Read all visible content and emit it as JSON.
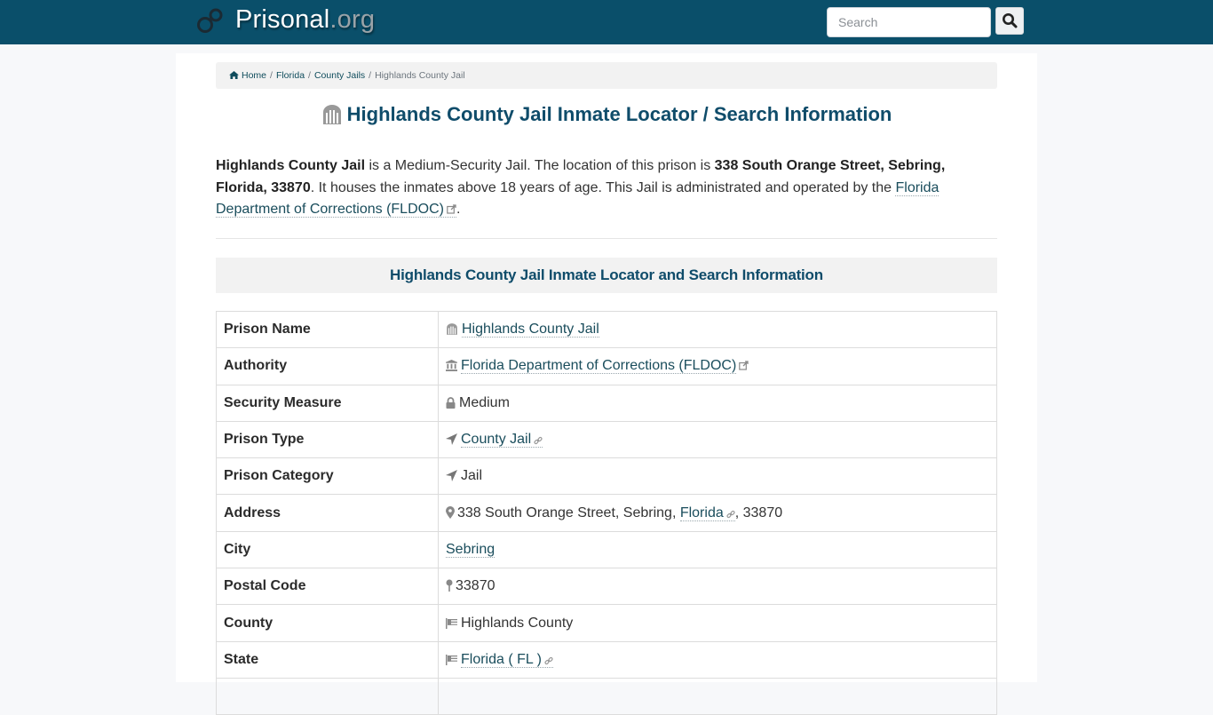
{
  "header": {
    "brand_name": "Prisonal",
    "brand_tld": ".org",
    "search_placeholder": "Search",
    "search_button_icon": "search-icon"
  },
  "breadcrumb": {
    "items": [
      {
        "label": "Home",
        "icon": "home-icon",
        "link": true
      },
      {
        "label": "Florida",
        "link": true
      },
      {
        "label": "County Jails",
        "link": true
      },
      {
        "label": "Highlands County Jail",
        "link": false
      }
    ],
    "separator": "/"
  },
  "page": {
    "title": "Highlands County Jail Inmate Locator / Search Information",
    "title_icon": "prison-icon"
  },
  "intro": {
    "jail_name": "Highlands County Jail",
    "text1": " is a Medium-Security Jail. The location of this prison is ",
    "address_bold": "338 South Orange Street, Sebring, Florida, 33870",
    "text2": ". It houses the inmates above 18 years of age. This Jail is administrated and operated by the ",
    "authority_link": "Florida Department of Corrections (FLDOC)",
    "text3": "."
  },
  "section": {
    "heading": "Highlands County Jail Inmate Locator and Search Information"
  },
  "table": {
    "rows": [
      {
        "label": "Prison Name",
        "icon": "prison-icon",
        "value": "Highlands County Jail",
        "link": true
      },
      {
        "label": "Authority",
        "icon": "institution-icon",
        "value": "Florida Department of Corrections (FLDOC)",
        "link": true,
        "external": true
      },
      {
        "label": "Security Measure",
        "icon": "lock-icon",
        "value": "Medium"
      },
      {
        "label": "Prison Type",
        "icon": "location-arrow-icon",
        "value": "County Jail",
        "link": true,
        "chain": true
      },
      {
        "label": "Prison Category",
        "icon": "location-arrow-icon",
        "value": "Jail"
      },
      {
        "label": "Address",
        "icon": "map-marker-icon",
        "value_prefix": "338 South Orange Street, Sebring, ",
        "value_link": "Florida",
        "value_suffix": ", 33870"
      },
      {
        "label": "City",
        "value": "Sebring",
        "link": true
      },
      {
        "label": "Postal Code",
        "icon": "map-pin-icon",
        "value": "33870"
      },
      {
        "label": "County",
        "icon": "flag-icon",
        "value": "Highlands County"
      },
      {
        "label": "State",
        "icon": "flag-icon",
        "value": "Florida ( FL )",
        "link": true,
        "chain": true
      }
    ]
  },
  "colors": {
    "header_bg": "#0a4f6a",
    "title": "#0f4c6a",
    "link": "#1a4d5c"
  }
}
